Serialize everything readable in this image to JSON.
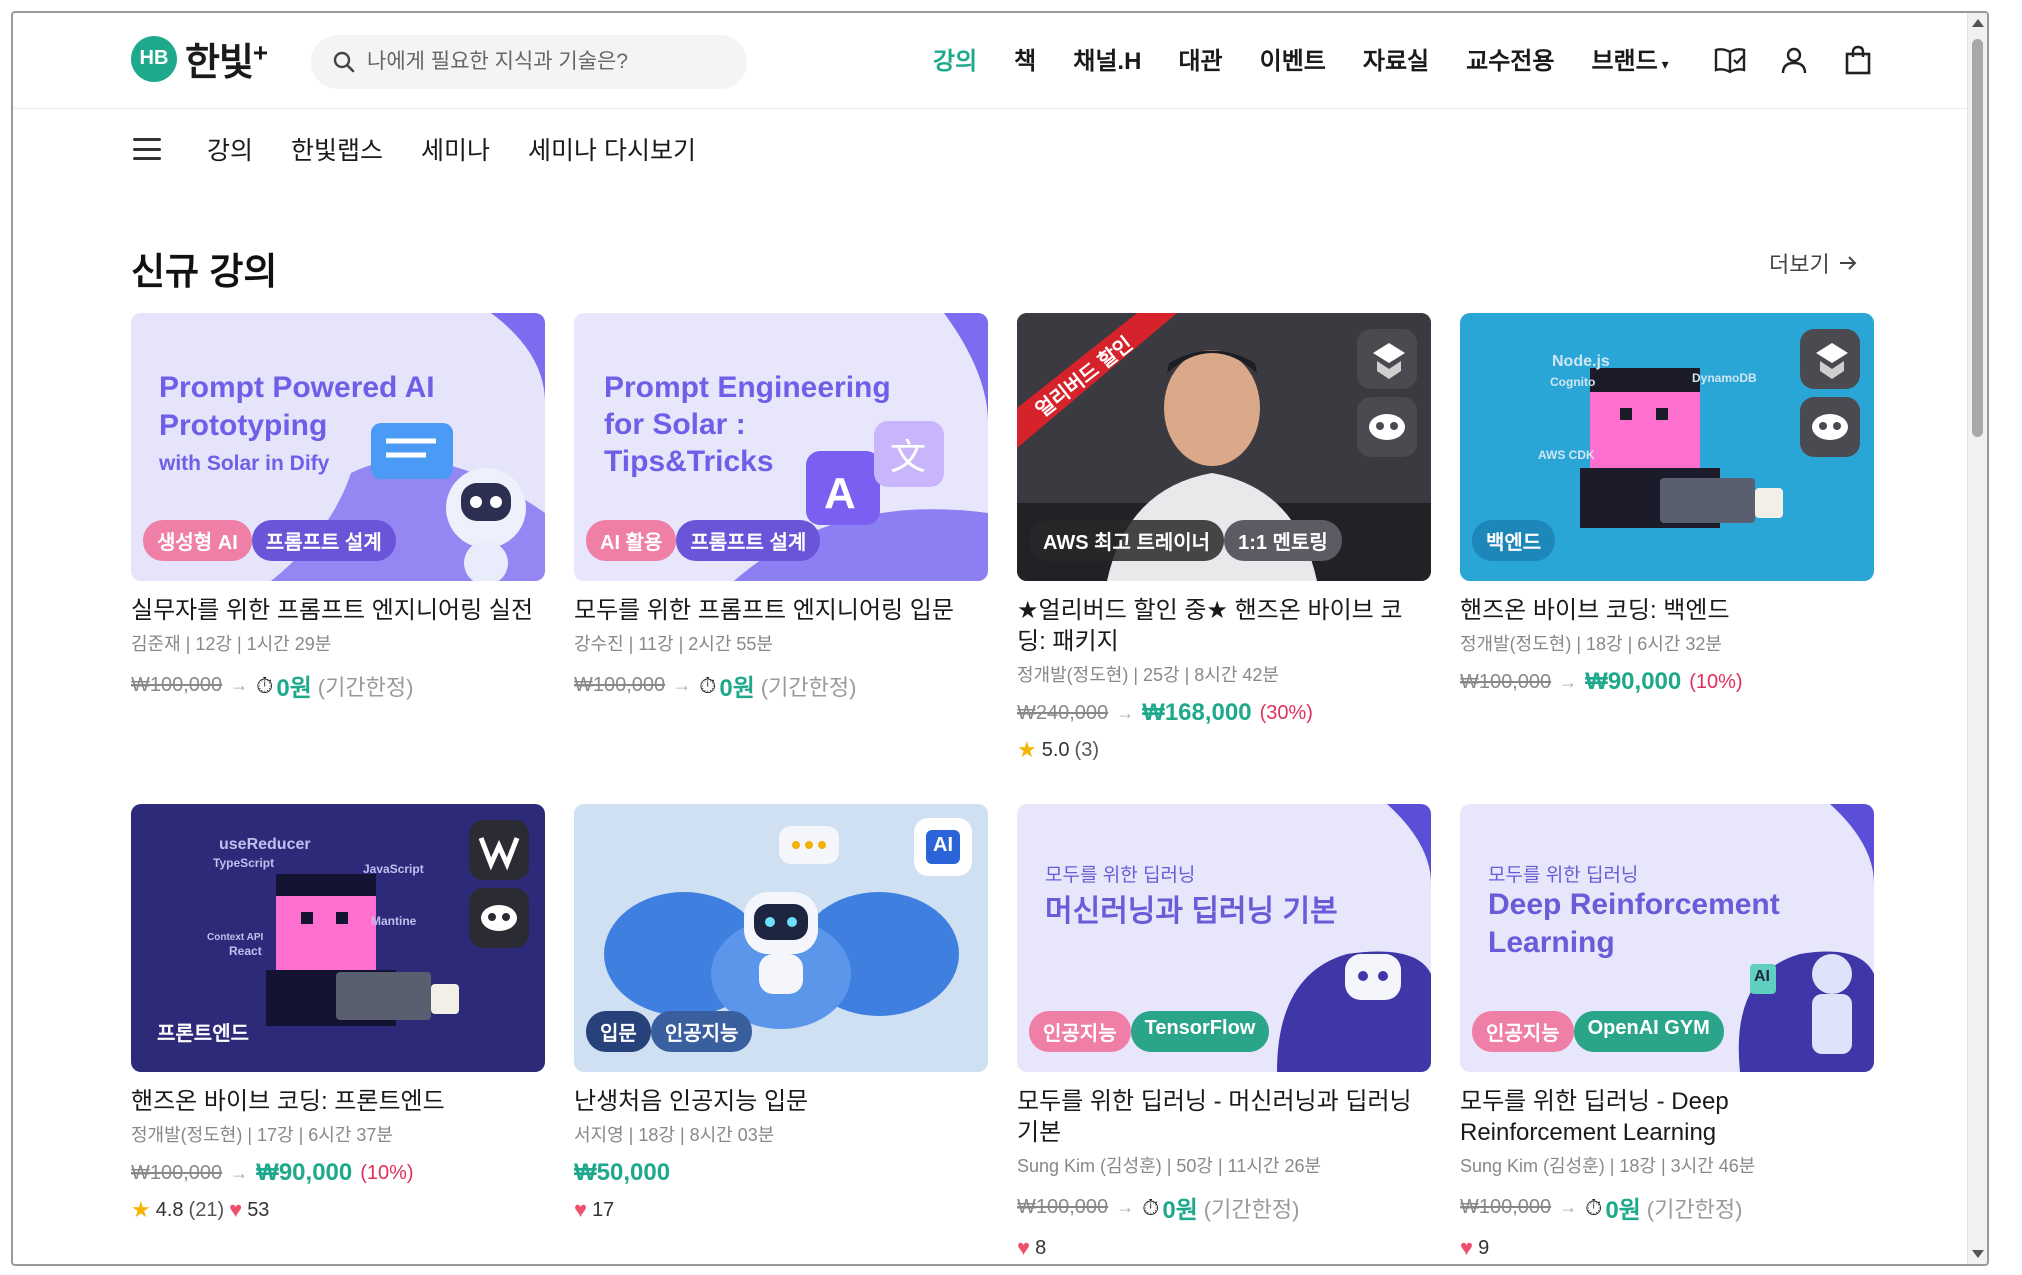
{
  "header": {
    "logo_mark": "HB",
    "logo_text": "한빛",
    "logo_plus": "+",
    "search_placeholder": "나에게 필요한 지식과 기술은?",
    "nav": [
      "강의",
      "책",
      "채널.H",
      "대관",
      "이벤트",
      "자료실",
      "교수전용",
      "브랜드"
    ],
    "active_nav": "강의"
  },
  "subnav": [
    "강의",
    "한빛랩스",
    "세미나",
    "세미나 다시보기"
  ],
  "section": {
    "title": "신규 강의",
    "more": "더보기"
  },
  "colors": {
    "accent": "#1fa98c",
    "discount": "#e0305a",
    "heart": "#f0506e",
    "star": "#f5b400"
  },
  "courses": [
    {
      "thumb_lines": [
        "Prompt Powered AI",
        "Prototyping",
        "with Solar in Dify"
      ],
      "tags": [
        "생성형 AI",
        "프롬프트 설계"
      ],
      "title": "실무자를 위한 프롬프트 엔지니어링 실전",
      "meta": "김준재 | 12강 | 1시간 29분",
      "orig": "₩100,000",
      "price": "0원",
      "note": "(기간한정)",
      "pct": ""
    },
    {
      "thumb_lines": [
        "Prompt Engineering",
        "for Solar :",
        "Tips&Tricks"
      ],
      "tags": [
        "AI 활용",
        "프롬프트 설계"
      ],
      "title": "모두를 위한 프롬프트 엔지니어링 입문",
      "meta": "강수진 | 11강 | 2시간 55분",
      "orig": "₩100,000",
      "price": "0원",
      "note": "(기간한정)",
      "pct": ""
    },
    {
      "ribbon": "얼리버드 할인",
      "tags": [
        "AWS 최고 트레이너",
        "1:1 멘토링"
      ],
      "title": "★얼리버드 할인 중★ 핸즈온 바이브 코딩: 패키지",
      "meta": "정개발(정도현) | 25강 | 8시간 42분",
      "orig": "₩240,000",
      "price": "₩168,000",
      "note": "",
      "pct": "(30%)",
      "rating": "5.0",
      "rating_count": "(3)"
    },
    {
      "thumb_labels": [
        "Node.js",
        "Cognito",
        "DynamoDB",
        "AWS CDK"
      ],
      "tags": [
        "백엔드"
      ],
      "title": "핸즈온 바이브 코딩: 백엔드",
      "meta": "정개발(정도현) | 18강 | 6시간 32분",
      "orig": "₩100,000",
      "price": "₩90,000",
      "note": "",
      "pct": "(10%)"
    },
    {
      "thumb_labels": [
        "useReducer",
        "TypeScript",
        "JavaScript",
        "Mantine",
        "Context API",
        "React"
      ],
      "tags": [
        "프론트엔드"
      ],
      "title": "핸즈온 바이브 코딩: 프론트엔드",
      "meta": "정개발(정도현) | 17강 | 6시간 37분",
      "orig": "₩100,000",
      "price": "₩90,000",
      "note": "",
      "pct": "(10%)",
      "rating": "4.8",
      "rating_count": "(21)",
      "likes": "53"
    },
    {
      "badge": "AI",
      "tags": [
        "입문",
        "인공지능"
      ],
      "title": "난생처음 인공지능 입문",
      "meta": "서지영 | 18강 | 8시간 03분",
      "orig": "",
      "price": "₩50,000",
      "note": "",
      "pct": "",
      "likes": "17"
    },
    {
      "thumb_lines": [
        "모두를 위한 딥러닝",
        "머신러닝과 딥러닝 기본"
      ],
      "tags": [
        "인공지능",
        "TensorFlow"
      ],
      "title": "모두를 위한 딥러닝 - 머신러닝과 딥러닝 기본",
      "meta": "Sung Kim (김성훈) | 50강 | 11시간 26분",
      "orig": "₩100,000",
      "price": "0원",
      "note": "(기간한정)",
      "pct": "",
      "likes": "8"
    },
    {
      "thumb_lines": [
        "모두를 위한 딥러닝",
        "Deep Reinforcement",
        "Learning"
      ],
      "badge": "AI",
      "tags": [
        "인공지능",
        "OpenAI GYM"
      ],
      "title": "모두를 위한 딥러닝 - Deep Reinforcement Learning",
      "meta": "Sung Kim (김성훈) | 18강 | 3시간 46분",
      "orig": "₩100,000",
      "price": "0원",
      "note": "(기간한정)",
      "pct": "",
      "likes": "9"
    }
  ]
}
